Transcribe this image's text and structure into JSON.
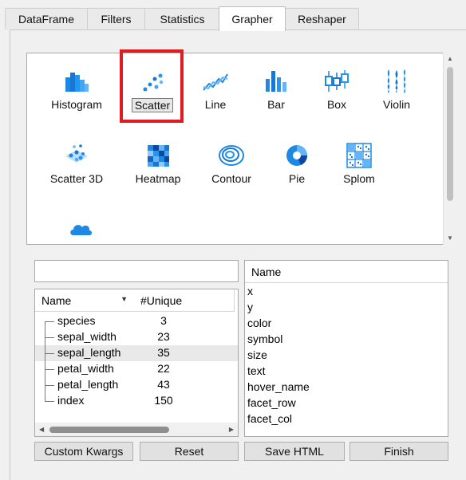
{
  "tabs": [
    {
      "label": "DataFrame"
    },
    {
      "label": "Filters"
    },
    {
      "label": "Statistics"
    },
    {
      "label": "Grapher",
      "active": true
    },
    {
      "label": "Reshaper"
    }
  ],
  "gallery": {
    "items": [
      {
        "label": "Histogram",
        "icon": "histogram-icon"
      },
      {
        "label": "Scatter",
        "icon": "scatter-icon",
        "selected": true
      },
      {
        "label": "Line",
        "icon": "line-icon"
      },
      {
        "label": "Bar",
        "icon": "bar-icon"
      },
      {
        "label": "Box",
        "icon": "box-icon"
      },
      {
        "label": "Violin",
        "icon": "violin-icon"
      },
      {
        "label": "Scatter 3D",
        "icon": "scatter-3d-icon"
      },
      {
        "label": "Heatmap",
        "icon": "heatmap-icon"
      },
      {
        "label": "Contour",
        "icon": "contour-icon"
      },
      {
        "label": "Pie",
        "icon": "pie-icon"
      },
      {
        "label": "Splom",
        "icon": "splom-icon"
      },
      {
        "label": "",
        "icon": "cloud-icon"
      }
    ],
    "accent_color": "#1e88e5",
    "highlight_color": "#e21b23"
  },
  "columns_panel": {
    "filter_value": "",
    "headers": {
      "name": "Name",
      "unique": "#Unique"
    },
    "rows": [
      {
        "name": "species",
        "unique": "3"
      },
      {
        "name": "sepal_width",
        "unique": "23"
      },
      {
        "name": "sepal_length",
        "unique": "35",
        "selected": true
      },
      {
        "name": "petal_width",
        "unique": "22"
      },
      {
        "name": "petal_length",
        "unique": "43"
      },
      {
        "name": "index",
        "unique": "150"
      }
    ]
  },
  "params_panel": {
    "header": "Name",
    "items": [
      "x",
      "y",
      "color",
      "symbol",
      "size",
      "text",
      "hover_name",
      "facet_row",
      "facet_col"
    ]
  },
  "buttons": {
    "custom_kwargs": "Custom Kwargs",
    "reset": "Reset",
    "save_html": "Save HTML",
    "finish": "Finish"
  }
}
